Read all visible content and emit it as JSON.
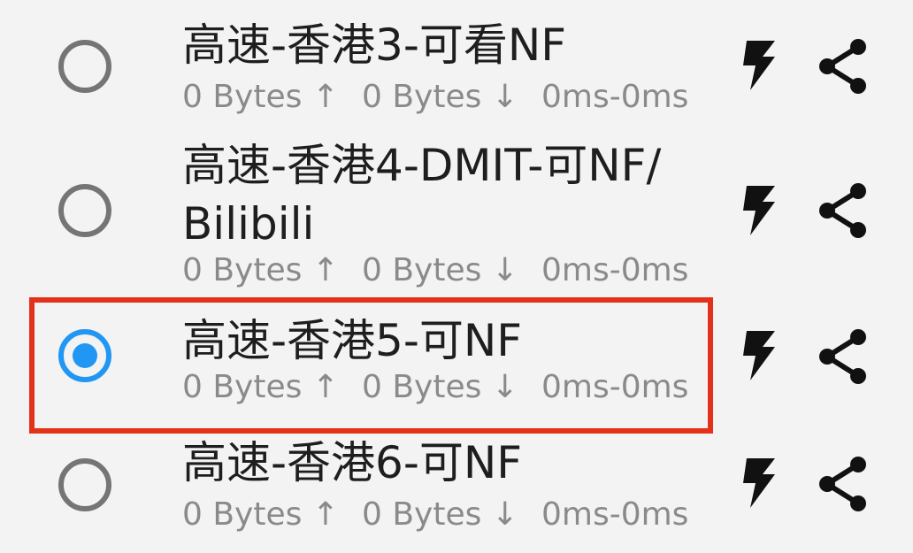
{
  "servers": [
    {
      "name": "高速-香港3-可看NF",
      "upload": "0 Bytes ↑",
      "download": "0 Bytes ↓",
      "latency": "0ms-0ms",
      "selected": false
    },
    {
      "name": "高速-香港4-DMIT-可NF/ Bilibili",
      "upload": "0 Bytes ↑",
      "download": "0 Bytes ↓",
      "latency": "0ms-0ms",
      "selected": false
    },
    {
      "name": "高速-香港5-可NF",
      "upload": "0 Bytes ↑",
      "download": "0 Bytes ↓",
      "latency": "0ms-0ms",
      "selected": true
    },
    {
      "name": "高速-香港6-可NF",
      "upload": "0 Bytes ↑",
      "download": "0 Bytes ↓",
      "latency": "0ms-0ms",
      "selected": false
    }
  ],
  "icons": {
    "test": "lightning-bolt-icon",
    "share": "share-icon"
  },
  "colors": {
    "accent": "#2196f3",
    "highlight": "#e3311b",
    "title": "#1e1e1e",
    "secondary": "#8a8a8a",
    "radio_off": "#757575"
  }
}
